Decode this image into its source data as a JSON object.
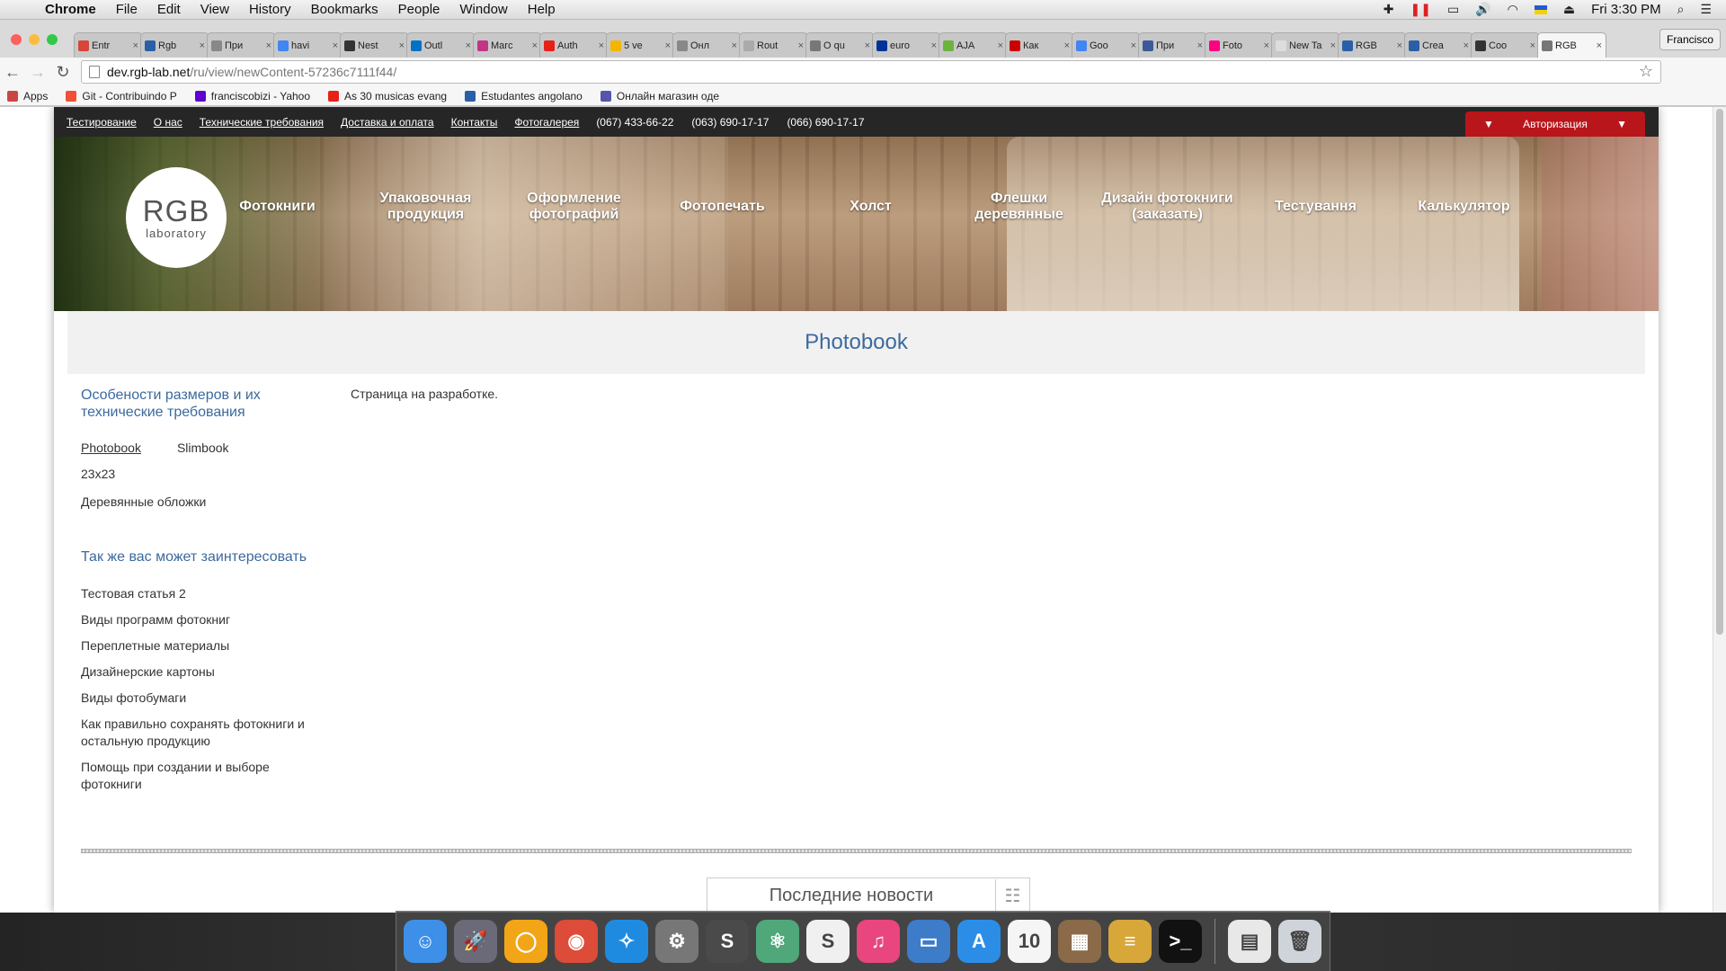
{
  "menubar": {
    "app": "Chrome",
    "items": [
      "File",
      "Edit",
      "View",
      "History",
      "Bookmarks",
      "People",
      "Window",
      "Help"
    ],
    "clock": "Fri 3:30 PM"
  },
  "tabs": [
    {
      "label": "Entr",
      "color": "#d44638"
    },
    {
      "label": "Rgb",
      "color": "#2a5fa8"
    },
    {
      "label": "При",
      "color": "#888888"
    },
    {
      "label": "havi",
      "color": "#4285f4"
    },
    {
      "label": "Nest",
      "color": "#333333"
    },
    {
      "label": "Outl",
      "color": "#0072c6"
    },
    {
      "label": "Marc",
      "color": "#c13584"
    },
    {
      "label": "Auth",
      "color": "#e62117"
    },
    {
      "label": "5 ve",
      "color": "#f4b400"
    },
    {
      "label": "Онл",
      "color": "#888888"
    },
    {
      "label": "Rout",
      "color": "#aaaaaa"
    },
    {
      "label": "О qu",
      "color": "#777777"
    },
    {
      "label": "euro",
      "color": "#003399"
    },
    {
      "label": "AJA",
      "color": "#6db33f"
    },
    {
      "label": "Как",
      "color": "#cc0000"
    },
    {
      "label": "Goo",
      "color": "#4285f4"
    },
    {
      "label": "При",
      "color": "#3b5998"
    },
    {
      "label": "Foto",
      "color": "#ff0084"
    },
    {
      "label": "New Ta",
      "color": "#dddddd"
    },
    {
      "label": "RGB",
      "color": "#2a5fa8"
    },
    {
      "label": "Crea",
      "color": "#2a5fa8"
    },
    {
      "label": "Coo",
      "color": "#333333"
    },
    {
      "label": "RGB",
      "color": "#777777"
    }
  ],
  "profile": "Francisco",
  "address": {
    "host": "dev.rgb-lab.net",
    "path": "/ru/view/newContent-57236c7111f44/"
  },
  "bookmarks": [
    {
      "label": "Apps",
      "color": "#cc4444"
    },
    {
      "label": "Git - Contribuindo P",
      "color": "#f05033"
    },
    {
      "label": "franciscobizi - Yahoo",
      "color": "#5f01d1"
    },
    {
      "label": "As 30 musicas evang",
      "color": "#e62117"
    },
    {
      "label": "Estudantes angolano",
      "color": "#2a5fa8"
    },
    {
      "label": "Онлайн магазин оде",
      "color": "#5555aa"
    }
  ],
  "site": {
    "toplinks": [
      "Тестирование",
      "О нас",
      "Технические требования",
      "Доставка и оплата",
      "Контакты",
      "Фотогалерея"
    ],
    "phones": [
      "(067) 433-66-22",
      "(063) 690-17-17",
      "(066) 690-17-17"
    ],
    "auth": "Авторизация",
    "logo": {
      "main": "RGB",
      "sub": "laboratory"
    },
    "nav": [
      "Фотокниги",
      "Упаковочная продукция",
      "Оформление фотографий",
      "Фотопечать",
      "Холст",
      "Флешки деревянные",
      "Дизайн фотокниги (заказать)",
      "Тестування",
      "Калькулятор"
    ],
    "page_title": "Photobook",
    "sidebar": {
      "heading": "Особености размеров и их технические требования",
      "size_tabs": [
        "Photobook",
        "Slimbook"
      ],
      "links": [
        "23x23",
        "Деревянные обложки"
      ],
      "related_heading": "Так же вас может заинтересовать",
      "related": [
        "Тестовая статья 2",
        "Виды программ фотокниг",
        "Переплетные материалы",
        "Дизайнерские картоны",
        "Виды фотобумаги",
        "Как правильно сохранять фотокниги и остальную продукцию",
        "Помощь при создании и выборе фотокниги"
      ]
    },
    "main_text": "Страница на разработке.",
    "news_title": "Последние новости"
  },
  "dock": [
    {
      "name": "finder-icon",
      "color": "#3d8fe8",
      "glyph": "☺"
    },
    {
      "name": "launchpad-icon",
      "color": "#6a6a78",
      "glyph": "🚀"
    },
    {
      "name": "chrome-canary-icon",
      "color": "#f2a516",
      "glyph": "◯"
    },
    {
      "name": "chrome-icon",
      "color": "#dd4b39",
      "glyph": "◉"
    },
    {
      "name": "safari-icon",
      "color": "#1f8be0",
      "glyph": "✧"
    },
    {
      "name": "system-preferences-icon",
      "color": "#777777",
      "glyph": "⚙"
    },
    {
      "name": "sublime-text-icon",
      "color": "#4a4a4a",
      "glyph": "S"
    },
    {
      "name": "atom-icon",
      "color": "#4fa77a",
      "glyph": "⚛"
    },
    {
      "name": "slack-icon",
      "color": "#f0f0f0",
      "glyph": "S"
    },
    {
      "name": "itunes-icon",
      "color": "#e9457e",
      "glyph": "♫"
    },
    {
      "name": "remote-desktop-icon",
      "color": "#3c7cc9",
      "glyph": "▭"
    },
    {
      "name": "app-store-icon",
      "color": "#2b8de6",
      "glyph": "A"
    },
    {
      "name": "calendar-icon",
      "color": "#f5f5f5",
      "glyph": "10"
    },
    {
      "name": "calculator-icon",
      "color": "#8a6a48",
      "glyph": "▦"
    },
    {
      "name": "sequel-pro-icon",
      "color": "#d7a73a",
      "glyph": "≡"
    },
    {
      "name": "terminal-icon",
      "color": "#111111",
      "glyph": ">_"
    },
    {
      "name": "downloads-icon",
      "color": "#e8e8e8",
      "glyph": "▤"
    },
    {
      "name": "trash-icon",
      "color": "#cfd4da",
      "glyph": "🗑"
    }
  ]
}
